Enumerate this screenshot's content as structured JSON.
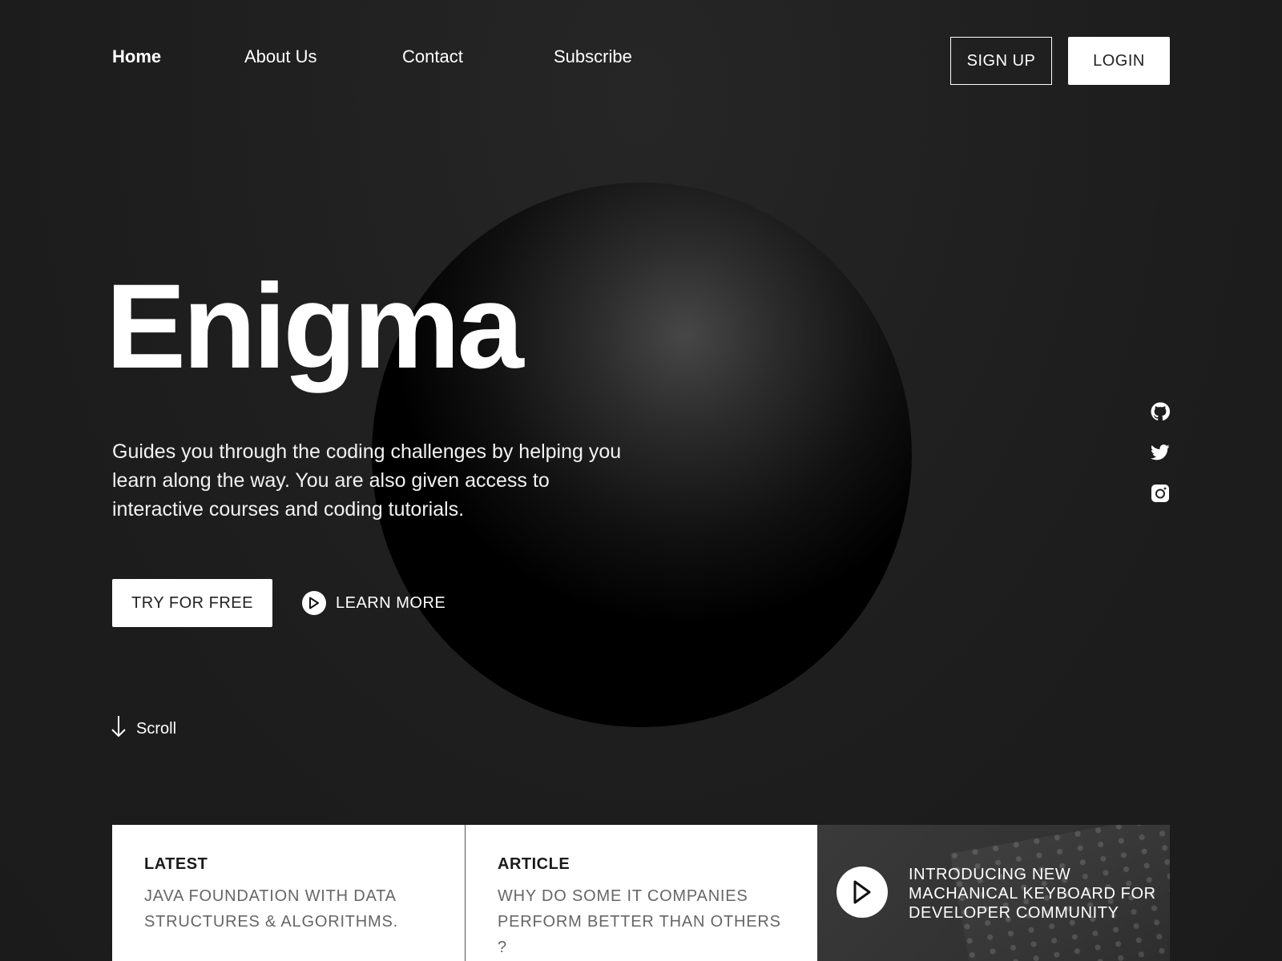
{
  "nav": {
    "items": [
      {
        "label": "Home",
        "active": true
      },
      {
        "label": "About Us"
      },
      {
        "label": "Contact"
      },
      {
        "label": "Subscribe"
      }
    ]
  },
  "auth": {
    "signup_label": "SIGN UP",
    "login_label": "LOGIN"
  },
  "hero": {
    "title": "Enigma",
    "description": "Guides you through the coding challenges by helping you learn along the way. You are also given access to interactive courses and coding tutorials.",
    "try_label": "TRY FOR FREE",
    "learn_label": "LEARN MORE",
    "scroll_label": "Scroll"
  },
  "social": {
    "icons": [
      "github-icon",
      "twitter-icon",
      "instagram-icon"
    ]
  },
  "cards": [
    {
      "tag": "LATEST",
      "text": "JAVA FOUNDATION WITH DATA STRUCTURES & ALGORITHMS."
    },
    {
      "tag": "ARTICLE",
      "text": "WHY DO SOME IT COMPANIES PERFORM BETTER THAN OTHERS ?"
    }
  ],
  "video_card": {
    "title": "INTRODUCING NEW MACHANICAL KEYBOARD FOR DEVELOPER COMMUNITY"
  },
  "colors": {
    "background": "#1e1e1e",
    "text": "#ffffff",
    "card_bg": "#ffffff",
    "card_muted_text": "#666666"
  }
}
